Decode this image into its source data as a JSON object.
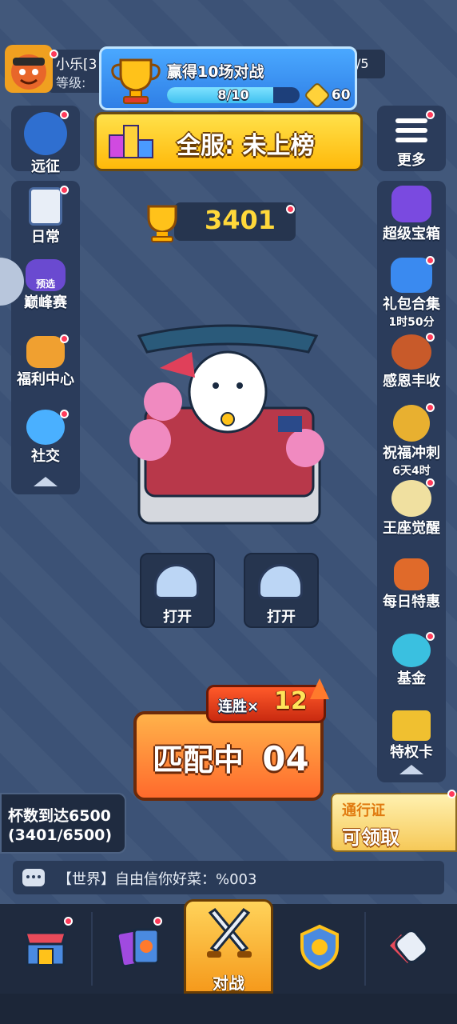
{
  "player": {
    "name": "小乐[3",
    "level_label": "等级:",
    "right_stat": "/5"
  },
  "quest": {
    "title": "赢得10场对战",
    "progress": "8/10",
    "progress_fraction": 0.8,
    "reward": "60"
  },
  "rank": {
    "text": "全服: 未上榜"
  },
  "trophy": {
    "count": "3401"
  },
  "left_sidebar": [
    {
      "label": "远征",
      "badge": ""
    },
    {
      "label": "日常",
      "badge": ""
    },
    {
      "label": "巅峰赛",
      "badge": "预选"
    },
    {
      "label": "福利中心",
      "badge": ""
    },
    {
      "label": "社交",
      "badge": ""
    }
  ],
  "right_sidebar": [
    {
      "label": "更多",
      "sub": ""
    },
    {
      "label": "超级宝箱",
      "sub": ""
    },
    {
      "label": "礼包合集",
      "sub": "1时50分"
    },
    {
      "label": "感恩丰收",
      "sub": ""
    },
    {
      "label": "祝福冲刺",
      "sub": "6天4时"
    },
    {
      "label": "王座觉醒",
      "sub": ""
    },
    {
      "label": "每日特惠",
      "sub": ""
    },
    {
      "label": "基金",
      "sub": ""
    },
    {
      "label": "特权卡",
      "sub": ""
    }
  ],
  "chests": [
    {
      "label": "打开"
    },
    {
      "label": "打开"
    }
  ],
  "match": {
    "label": "匹配中",
    "timer": "04",
    "streak_label": "连胜×",
    "streak_count": "12"
  },
  "cup_goal": {
    "title": "杯数到达6500",
    "progress": "(3401/6500)"
  },
  "pass": {
    "title": "通行证",
    "claim": "可领取"
  },
  "chat": {
    "message": "【世界】自由信你好菜：%003"
  },
  "bottom_nav": [
    {
      "name": "shop",
      "label": ""
    },
    {
      "name": "cards",
      "label": ""
    },
    {
      "name": "battle",
      "label": "对战"
    },
    {
      "name": "clan",
      "label": ""
    },
    {
      "name": "events",
      "label": ""
    }
  ],
  "colors": {
    "background": "#3d5478",
    "accent_orange": "#ff7a2c",
    "gold": "#ffd83a",
    "badge_red": "#ff3b5a"
  }
}
